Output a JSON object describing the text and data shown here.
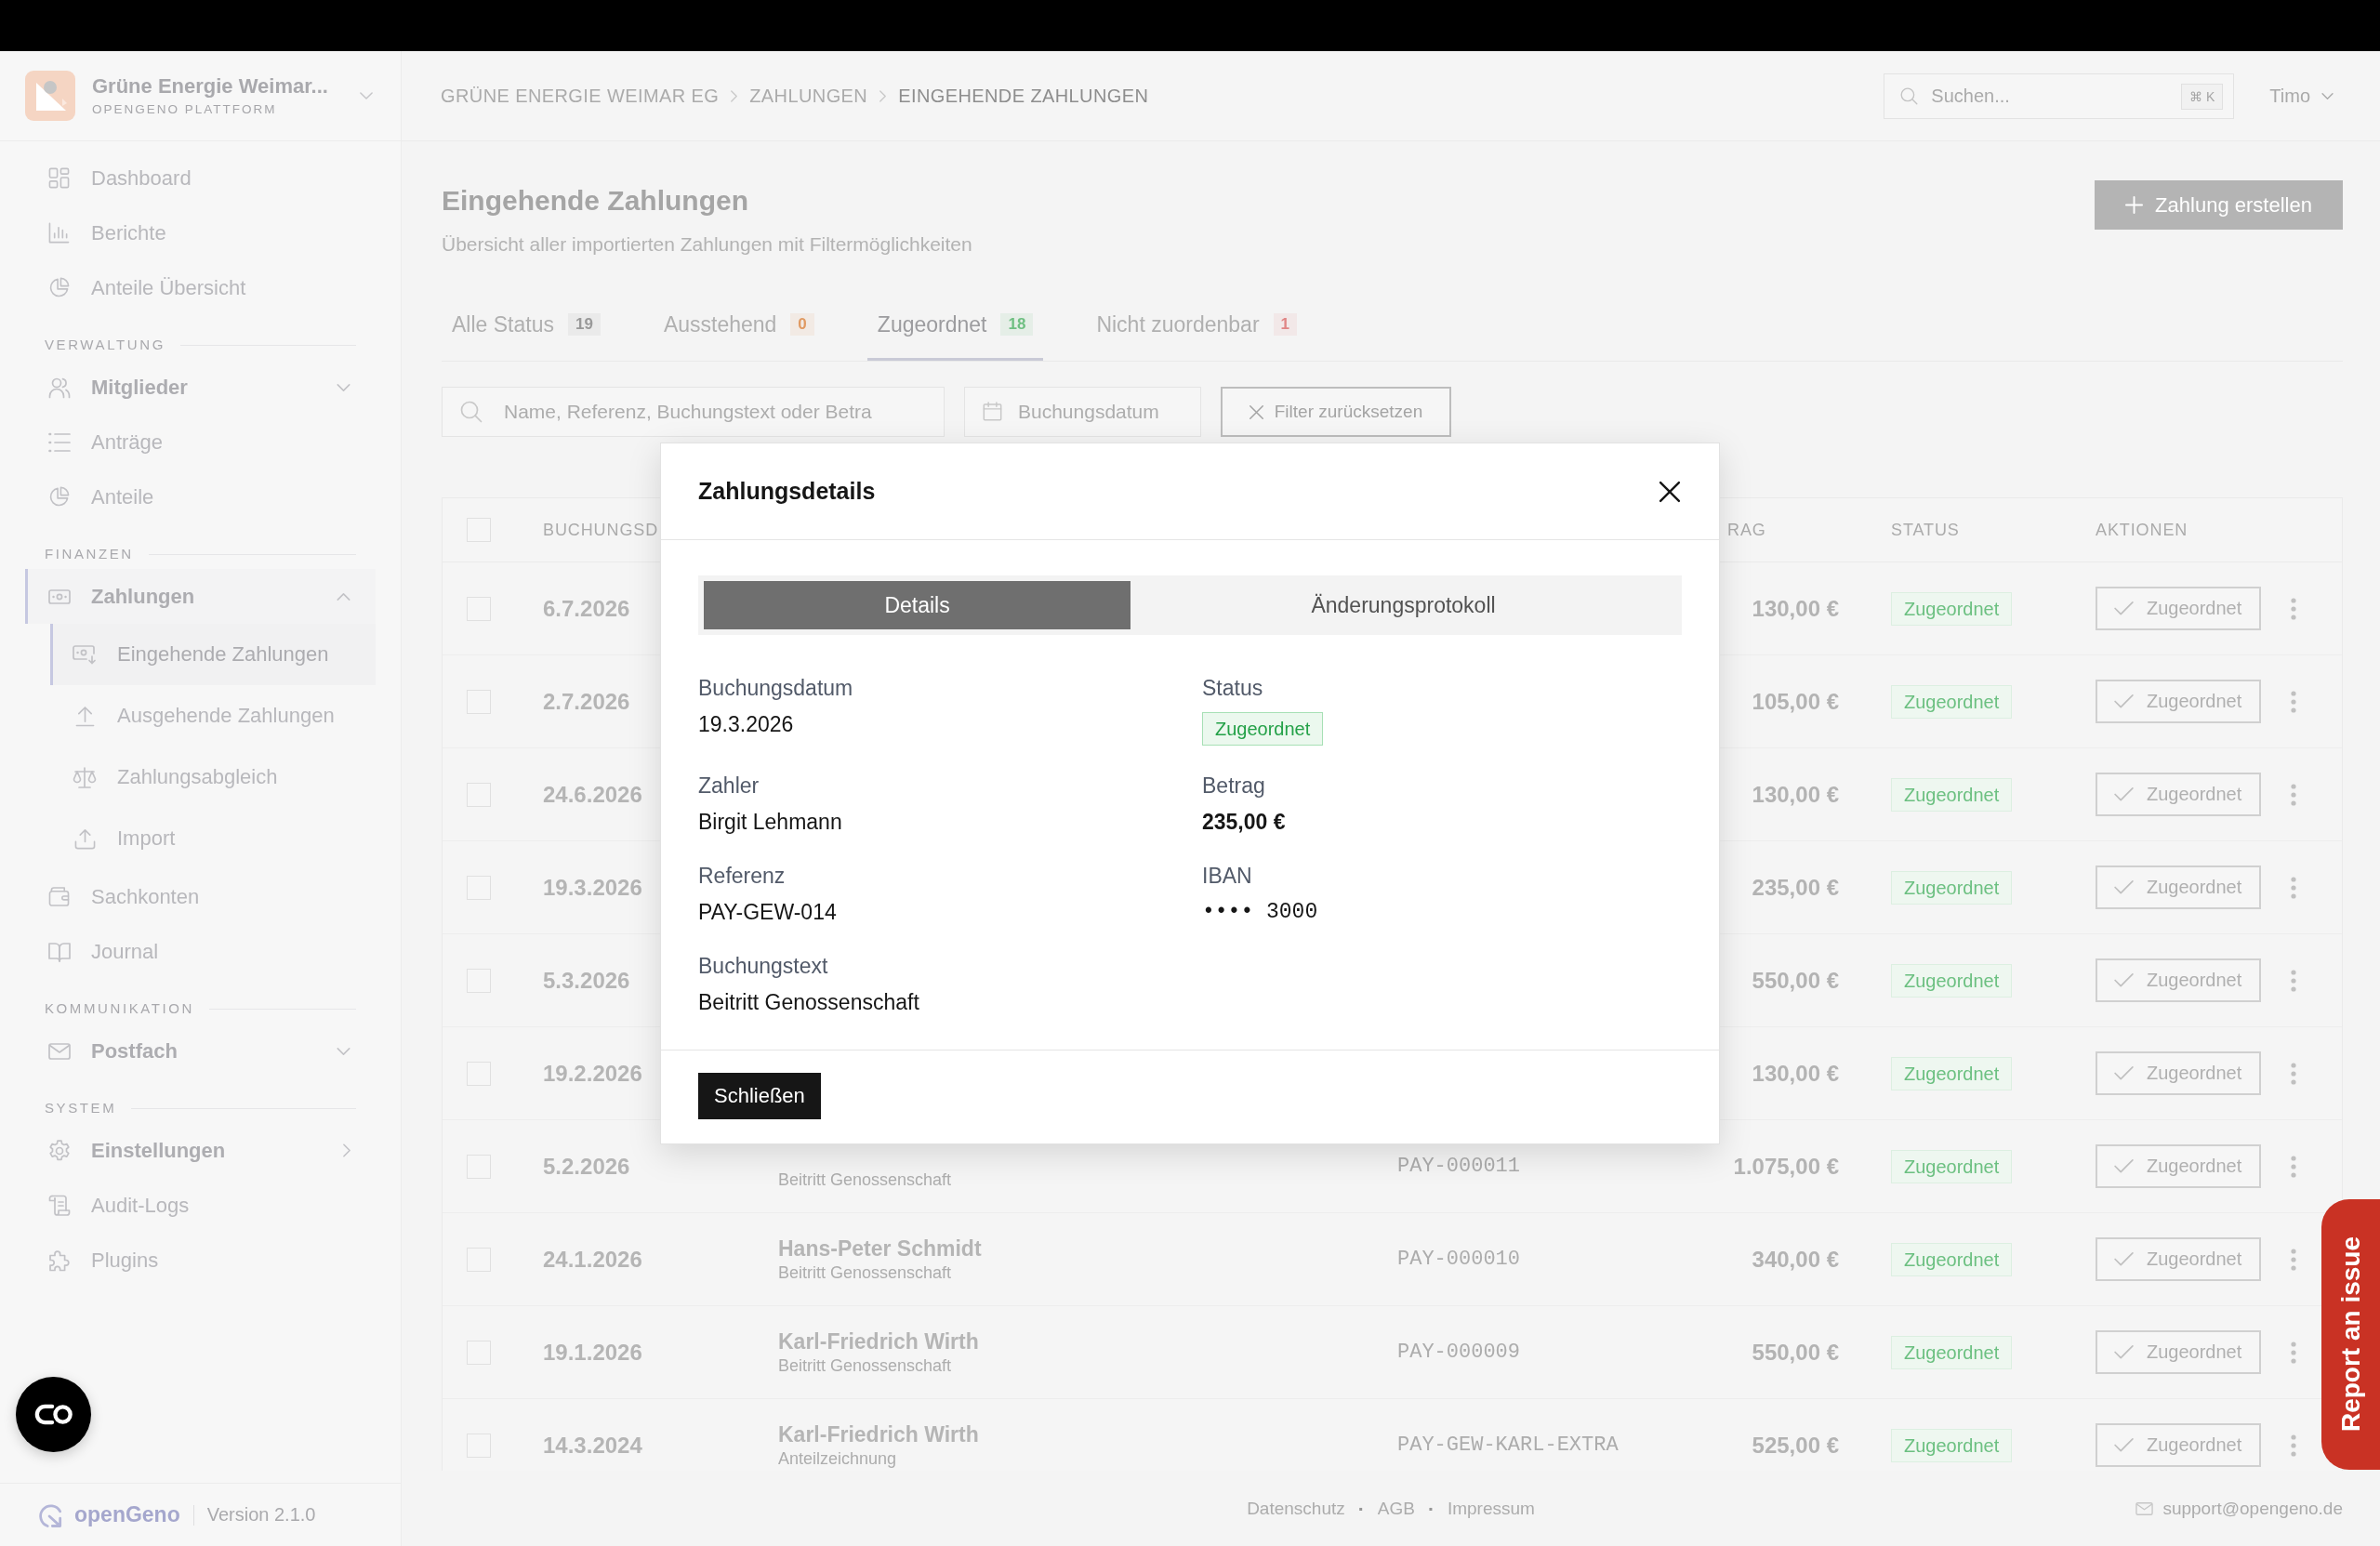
{
  "sidebar": {
    "brand": {
      "name": "Grüne Energie Weimar...",
      "subtitle": "OPENGENO PLATTFORM"
    },
    "groups": [
      {
        "items": [
          {
            "label": "Dashboard",
            "kind": "link",
            "selected": false
          },
          {
            "label": "Berichte",
            "kind": "link",
            "selected": false
          },
          {
            "label": "Anteile Übersicht",
            "kind": "link",
            "selected": false
          }
        ]
      },
      {
        "heading": "VERWALTUNG",
        "items": [
          {
            "label": "Mitglieder",
            "kind": "group",
            "expanded": false,
            "selected": false
          },
          {
            "label": "Anträge",
            "kind": "link",
            "selected": false
          },
          {
            "label": "Anteile",
            "kind": "link",
            "selected": false
          }
        ]
      },
      {
        "heading": "FINANZEN",
        "items": [
          {
            "label": "Zahlungen",
            "kind": "group",
            "expanded": true,
            "selected": true,
            "children": [
              {
                "label": "Eingehende Zahlungen",
                "selected": true
              },
              {
                "label": "Ausgehende Zahlungen",
                "selected": false
              },
              {
                "label": "Zahlungsabgleich",
                "selected": false
              },
              {
                "label": "Import",
                "selected": false
              }
            ]
          },
          {
            "label": "Sachkonten",
            "kind": "link",
            "selected": false
          },
          {
            "label": "Journal",
            "kind": "link",
            "selected": false
          }
        ]
      },
      {
        "heading": "KOMMUNIKATION",
        "items": [
          {
            "label": "Postfach",
            "kind": "group",
            "expanded": false,
            "selected": false
          }
        ]
      },
      {
        "heading": "SYSTEM",
        "items": [
          {
            "label": "Einstellungen",
            "kind": "submenu",
            "selected": false
          },
          {
            "label": "Audit-Logs",
            "kind": "link",
            "selected": false
          },
          {
            "label": "Plugins",
            "kind": "link",
            "selected": false
          }
        ]
      }
    ],
    "footer": {
      "product": "openGeno",
      "version": "Version 2.1.0"
    }
  },
  "topbar": {
    "breadcrumb": [
      {
        "label": "GRÜNE ENERGIE WEIMAR EG",
        "current": false
      },
      {
        "label": "ZAHLUNGEN",
        "current": false
      },
      {
        "label": "EINGEHENDE ZAHLUNGEN",
        "current": true
      }
    ],
    "search": {
      "placeholder": "Suchen...",
      "shortcut": "⌘ K"
    },
    "user": "Timo"
  },
  "page": {
    "title": "Eingehende Zahlungen",
    "subtitle": "Übersicht aller importierten Zahlungen mit Filtermöglichkeiten",
    "create_button": "Zahlung erstellen"
  },
  "tabs": [
    {
      "label": "Alle Status",
      "count": "19",
      "color": "#999999",
      "selected": false
    },
    {
      "label": "Ausstehend",
      "count": "0",
      "color": "#e09a62",
      "selected": false
    },
    {
      "label": "Zugeordnet",
      "count": "18",
      "color": "#6fbf82",
      "selected": true
    },
    {
      "label": "Nicht zuordenbar",
      "count": "1",
      "color": "#e08585",
      "selected": false
    }
  ],
  "filters": {
    "search": {
      "placeholder": "Name, Referenz, Buchungstext oder Betra"
    },
    "date": {
      "placeholder": "Buchungsdatum"
    },
    "reset_button": "Filter zurücksetzen"
  },
  "table": {
    "select_all": false,
    "columns": [
      "BUCHUNGSD",
      "RAG",
      "STATUS",
      "AKTIONEN"
    ],
    "rows": [
      {
        "selected": false,
        "date": "6.7.2026",
        "amount": "130,00 €",
        "status": "Zugeordnet",
        "action": "Zugeordnet"
      },
      {
        "selected": false,
        "date": "2.7.2026",
        "amount": "105,00 €",
        "status": "Zugeordnet",
        "action": "Zugeordnet"
      },
      {
        "selected": false,
        "date": "24.6.2026",
        "amount": "130,00 €",
        "status": "Zugeordnet",
        "action": "Zugeordnet"
      },
      {
        "selected": false,
        "date": "19.3.2026",
        "amount": "235,00 €",
        "status": "Zugeordnet",
        "action": "Zugeordnet"
      },
      {
        "selected": false,
        "date": "5.3.2026",
        "amount": "550,00 €",
        "status": "Zugeordnet",
        "action": "Zugeordnet"
      },
      {
        "selected": false,
        "date": "19.2.2026",
        "amount": "130,00 €",
        "status": "Zugeordnet",
        "action": "Zugeordnet"
      },
      {
        "selected": false,
        "date": "5.2.2026",
        "note": "Beitritt Genossenschaft",
        "reference": "PAY-000011",
        "amount": "1.075,00 €",
        "status": "Zugeordnet",
        "action": "Zugeordnet"
      },
      {
        "selected": false,
        "date": "24.1.2026",
        "name": "Hans-Peter Schmidt",
        "note": "Beitritt Genossenschaft",
        "reference": "PAY-000010",
        "amount": "340,00 €",
        "status": "Zugeordnet",
        "action": "Zugeordnet"
      },
      {
        "selected": false,
        "date": "19.1.2026",
        "name": "Karl-Friedrich Wirth",
        "note": "Beitritt Genossenschaft",
        "reference": "PAY-000009",
        "amount": "550,00 €",
        "status": "Zugeordnet",
        "action": "Zugeordnet"
      },
      {
        "selected": false,
        "date": "14.3.2024",
        "name": "Karl-Friedrich Wirth",
        "note": "Anteilzeichnung",
        "reference": "PAY-GEW-KARL-EXTRA",
        "amount": "525,00 €",
        "status": "Zugeordnet",
        "action": "Zugeordnet"
      }
    ]
  },
  "footer": {
    "links": [
      {
        "kind": "link",
        "label": "Datenschutz"
      },
      {
        "kind": "separator",
        "label": "·"
      },
      {
        "kind": "link",
        "label": "AGB"
      },
      {
        "kind": "separator",
        "label": "·"
      },
      {
        "kind": "link",
        "label": "Impressum"
      }
    ],
    "email": "support@opengeno.de"
  },
  "dialog": {
    "title": "Zahlungsdetails",
    "tabs": [
      {
        "label": "Details",
        "selected": true
      },
      {
        "label": "Änderungsprotokoll",
        "selected": false
      }
    ],
    "fields": [
      {
        "label": "Buchungsdatum",
        "value": "19.3.2026",
        "kind": "text"
      },
      {
        "label": "Status",
        "value": "Zugeordnet",
        "kind": "badge"
      },
      {
        "label": "Zahler",
        "value": "Birgit Lehmann",
        "kind": "text"
      },
      {
        "label": "Betrag",
        "value": "235,00 €",
        "kind": "amount"
      },
      {
        "label": "Referenz",
        "value": "PAY-GEW-014",
        "kind": "text"
      },
      {
        "label": "IBAN",
        "value": "•••• 3000",
        "kind": "mono"
      },
      {
        "label": "Buchungstext",
        "value": "Beitritt Genossenschaft",
        "kind": "text"
      }
    ],
    "close_button": "Schließen"
  },
  "report_button": "Report an issue"
}
